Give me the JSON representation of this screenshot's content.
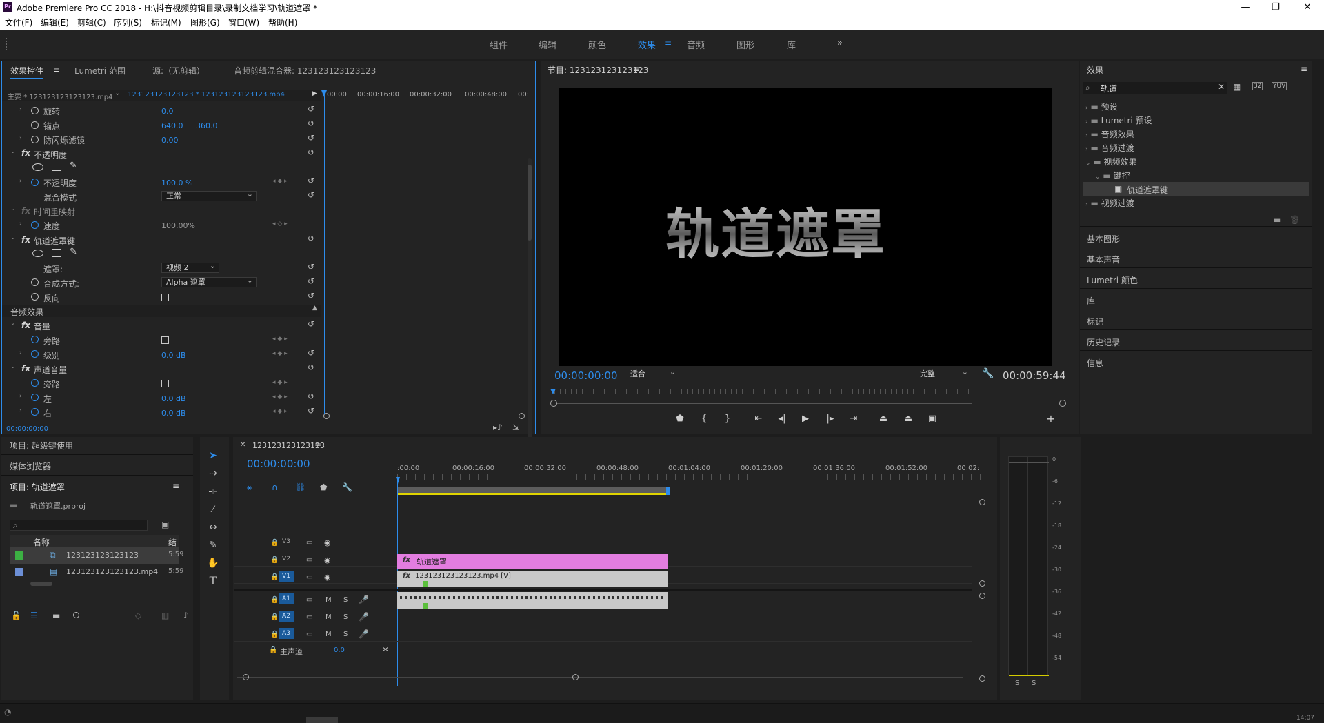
{
  "app": {
    "title": "Adobe Premiere Pro CC 2018 - H:\\抖音视频剪辑目录\\录制文档学习\\轨道遮罩 *",
    "logo": "Pr"
  },
  "window_controls": {
    "minimize": "—",
    "restore": "❐",
    "close": "✕"
  },
  "menu": [
    "文件(F)",
    "编辑(E)",
    "剪辑(C)",
    "序列(S)",
    "标记(M)",
    "图形(G)",
    "窗口(W)",
    "帮助(H)"
  ],
  "workspaces": [
    "组件",
    "编辑",
    "颜色",
    "效果",
    "音频",
    "图形",
    "库"
  ],
  "workspace_active": "效果",
  "workspace_more": "»",
  "effect_controls": {
    "tabs": [
      "效果控件",
      "Lumetri 范围",
      "源:（无剪辑）",
      "音频剪辑混合器: 123123123123123"
    ],
    "master_clip": "主要 * 123123123123123.mp4",
    "seq_clip": "123123123123123 * 123123123123123.mp4",
    "ruler": [
      "00:00",
      "00:00:16:00",
      "00:00:32:00",
      "00:00:48:00",
      "00:"
    ],
    "rows": {
      "rotation": {
        "label": "旋转",
        "value": "0.0"
      },
      "anchor": {
        "label": "锚点",
        "x": "640.0",
        "y": "360.0"
      },
      "flicker": {
        "label": "防闪烁滤镜",
        "value": "0.00"
      },
      "opacity_sec": "不透明度",
      "opacity": {
        "label": "不透明度",
        "value": "100.0 %"
      },
      "blend": {
        "label": "混合模式",
        "value": "正常"
      },
      "time_remap": "时间重映射",
      "speed": {
        "label": "速度",
        "value": "100.00%"
      },
      "track_matte": "轨道遮罩键",
      "matte": {
        "label": "遮罩:",
        "value": "视频 2"
      },
      "composite": {
        "label": "合成方式:",
        "value": "Alpha 遮罩"
      },
      "reverse": {
        "label": "反向"
      },
      "audio_effects": "音频效果",
      "volume_sec": "音量",
      "bypass1": {
        "label": "旁路"
      },
      "level": {
        "label": "级别",
        "value": "0.0 dB"
      },
      "channel_sec": "声道音量",
      "bypass2": {
        "label": "旁路"
      },
      "left": {
        "label": "左",
        "value": "0.0 dB"
      },
      "right": {
        "label": "右",
        "value": "0.0 dB"
      }
    },
    "fx_mark": "fx",
    "timecode": "00:00:00:00"
  },
  "program": {
    "title": "节目: 123123123123123",
    "overlay_text": "轨道遮罩",
    "timecode": "00:00:00:00",
    "fit": "适合",
    "quality": "完整",
    "duration": "00:00:59:44"
  },
  "effects_panel": {
    "title": "效果",
    "search_value": "轨道",
    "tree": [
      {
        "label": "预设",
        "level": 0,
        "expanded": false
      },
      {
        "label": "Lumetri 预设",
        "level": 0,
        "expanded": false
      },
      {
        "label": "音频效果",
        "level": 0,
        "expanded": false
      },
      {
        "label": "音频过渡",
        "level": 0,
        "expanded": false
      },
      {
        "label": "视频效果",
        "level": 0,
        "expanded": true
      },
      {
        "label": "键控",
        "level": 1,
        "expanded": true
      },
      {
        "label": "轨道遮罩键",
        "level": 2,
        "selected": true
      },
      {
        "label": "视频过渡",
        "level": 0,
        "expanded": false
      }
    ],
    "sections": [
      "基本图形",
      "基本声音",
      "Lumetri 颜色",
      "库",
      "标记",
      "历史记录",
      "信息"
    ]
  },
  "project": {
    "tabs": [
      "项目: 超级键使用",
      "媒体浏览器"
    ],
    "title": "项目: 轨道遮罩",
    "file": "轨道遮罩.prproj",
    "col_name": "名称",
    "col_rate": "结",
    "items": [
      {
        "name": "123123123123123",
        "rate": "5:59",
        "color": "#3cb043"
      },
      {
        "name": "123123123123123.mp4",
        "rate": "5:59",
        "color": "#6c8fd6"
      }
    ]
  },
  "timeline": {
    "seq_name": "123123123123123",
    "timecode": "00:00:00:00",
    "ruler": [
      ":00:00",
      "00:00:16:00",
      "00:00:32:00",
      "00:00:48:00",
      "00:01:04:00",
      "00:01:20:00",
      "00:01:36:00",
      "00:01:52:00",
      "00:02:"
    ],
    "video_tracks": [
      "V3",
      "V2",
      "V1"
    ],
    "audio_tracks": [
      "A1",
      "A2",
      "A3"
    ],
    "mute": "M",
    "solo": "S",
    "master": {
      "label": "主声道",
      "value": "0.0"
    },
    "clips": {
      "v2": "轨道遮罩",
      "v1": "123123123123123.mp4 [V]"
    }
  },
  "meter": {
    "scale": [
      "0",
      "-6",
      "-12",
      "-18",
      "-24",
      "-30",
      "-36",
      "-42",
      "-48",
      "-54"
    ],
    "solo_labels": [
      "S",
      "S"
    ]
  },
  "status": {
    "right_text": "14:07"
  }
}
